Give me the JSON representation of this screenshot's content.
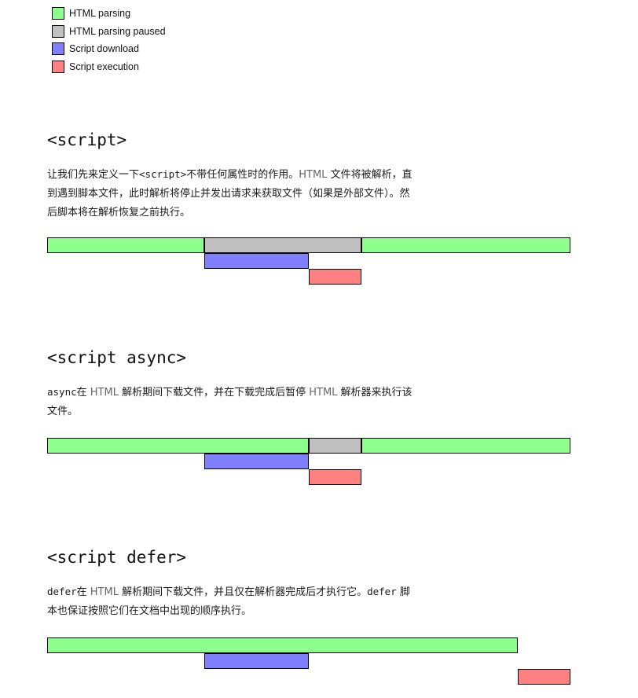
{
  "colors": {
    "parsing": "#8cff8c",
    "paused": "#c0c0c0",
    "download": "#8080ff",
    "execution": "#ff8080"
  },
  "legend": [
    {
      "key": "parsing",
      "label": "HTML parsing"
    },
    {
      "key": "paused",
      "label": "HTML parsing paused"
    },
    {
      "key": "download",
      "label": "Script download"
    },
    {
      "key": "execution",
      "label": "Script execution"
    }
  ],
  "timeline_scale": 10,
  "sections": [
    {
      "heading": "<script>",
      "desc": [
        {
          "text": "让我们先来定义一下"
        },
        {
          "text": "<script>",
          "mono": true
        },
        {
          "text": "不带任何属性时的作用。"
        },
        {
          "text": "HTML",
          "dim": true
        },
        {
          "text": " 文件将被解析，直到遇到脚本文件，此时解析将停止并发出请求来获取文件（如果是外部文件）。然后脚本将在解析恢复之前执行。"
        }
      ],
      "bars": [
        {
          "type": "parsing",
          "row": 0,
          "start": 0,
          "end": 3
        },
        {
          "type": "paused",
          "row": 0,
          "start": 3,
          "end": 6
        },
        {
          "type": "parsing",
          "row": 0,
          "start": 6,
          "end": 10
        },
        {
          "type": "download",
          "row": 1,
          "start": 3,
          "end": 5
        },
        {
          "type": "execution",
          "row": 2,
          "start": 5,
          "end": 6
        }
      ]
    },
    {
      "heading": "<script async>",
      "desc": [
        {
          "text": "async",
          "mono": true
        },
        {
          "text": "在 "
        },
        {
          "text": "HTML",
          "dim": true
        },
        {
          "text": " 解析期间下载文件，并在下载完成后暂停 "
        },
        {
          "text": "HTML",
          "dim": true
        },
        {
          "text": " 解析器来执行该文件。"
        }
      ],
      "bars": [
        {
          "type": "parsing",
          "row": 0,
          "start": 0,
          "end": 5
        },
        {
          "type": "paused",
          "row": 0,
          "start": 5,
          "end": 6
        },
        {
          "type": "parsing",
          "row": 0,
          "start": 6,
          "end": 10
        },
        {
          "type": "download",
          "row": 1,
          "start": 3,
          "end": 5
        },
        {
          "type": "execution",
          "row": 2,
          "start": 5,
          "end": 6
        }
      ]
    },
    {
      "heading": "<script defer>",
      "desc": [
        {
          "text": "defer",
          "mono": true
        },
        {
          "text": "在 "
        },
        {
          "text": "HTML",
          "dim": true
        },
        {
          "text": " 解析期间下载文件，并且仅在解析器完成后才执行它。"
        },
        {
          "text": "defer",
          "mono": true
        },
        {
          "text": " 脚本也保证按照它们在文档中出现的顺序执行。"
        }
      ],
      "bars": [
        {
          "type": "parsing",
          "row": 0,
          "start": 0,
          "end": 9
        },
        {
          "type": "download",
          "row": 1,
          "start": 3,
          "end": 5
        },
        {
          "type": "execution",
          "row": 2,
          "start": 9,
          "end": 10
        }
      ]
    }
  ]
}
